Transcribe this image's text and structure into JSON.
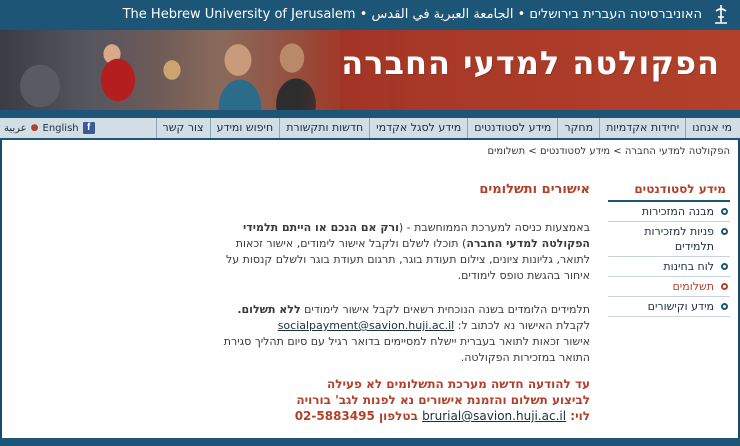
{
  "topbar": {
    "university": "The Hebrew University of Jerusalem • האוניברסיטה העברית בירושלים • الجامعة العبرية في القدس",
    "logo_icon": "university-logo-icon"
  },
  "banner": {
    "faculty_title": "הפקולטה למדעי החברה"
  },
  "nav": {
    "items": [
      "מי אנחנו",
      "יחידות אקדמיות",
      "מחקר",
      "מידע לסטודנטים",
      "מידע לסגל אקדמי",
      "חדשות ותקשורת",
      "חיפוש ומידע",
      "צור קשר"
    ],
    "lang_english": "English",
    "lang_arabic": "عربية",
    "facebook_icon": "facebook-icon"
  },
  "breadcrumb": {
    "home": "הפקולטה למדעי החברה",
    "section": "מידע לסטודנטים",
    "current": "תשלומים",
    "sep": ">"
  },
  "sidebar": {
    "heading": "מידע לסטודנטים",
    "links": [
      "מבנה המזכירות",
      "פניות למזכירות תלמידים",
      "לוח בחינות",
      "תשלומים",
      "מידע וקישורים"
    ],
    "active_index": 3
  },
  "main": {
    "title": "אישורים ותשלומים",
    "p1_a": "באמצעות כניסה למערכת הממוחשבת - (",
    "p1_b": "ורק אם הנכם או הייתם תלמידי הפקולטה למדעי החברה",
    "p1_c": ") תוכלו לשלם ולקבל אישור לימודים, אישור זכאות לתואר, גליונות ציונים, צילום תעודת בוגר, תרגום תעודת בוגר ולשלם קנסות על איחור בהגשת טופס לימודים.",
    "p2_a": "תלמידים הלומדים בשנה הנוכחית רשאים לקבל אישור לימודים ",
    "p2_b": "ללא תשלום.",
    "p2_c": " לקבלת האישור נא לכתוב ל: ",
    "p2_email": "socialpayment@savion.huji.ac.il",
    "p2_d": "אישור זכאות לתואר בעברית יישלח למסיימים בדואר רגיל עם סיום תהליך סגירת התואר במזכירות הפקולטה."
  },
  "notice": {
    "line1": "עד להודעה חדשה מערכת התשלומים לא פעילה",
    "line2": "לביצוע תשלום והזמנת אישורים נא לפנות לגב' בורויה",
    "line3_a": "לוי: ",
    "email": "brurial@savion.huji.ac.il",
    "line3_b": " בטלפון 02-5883495"
  }
}
